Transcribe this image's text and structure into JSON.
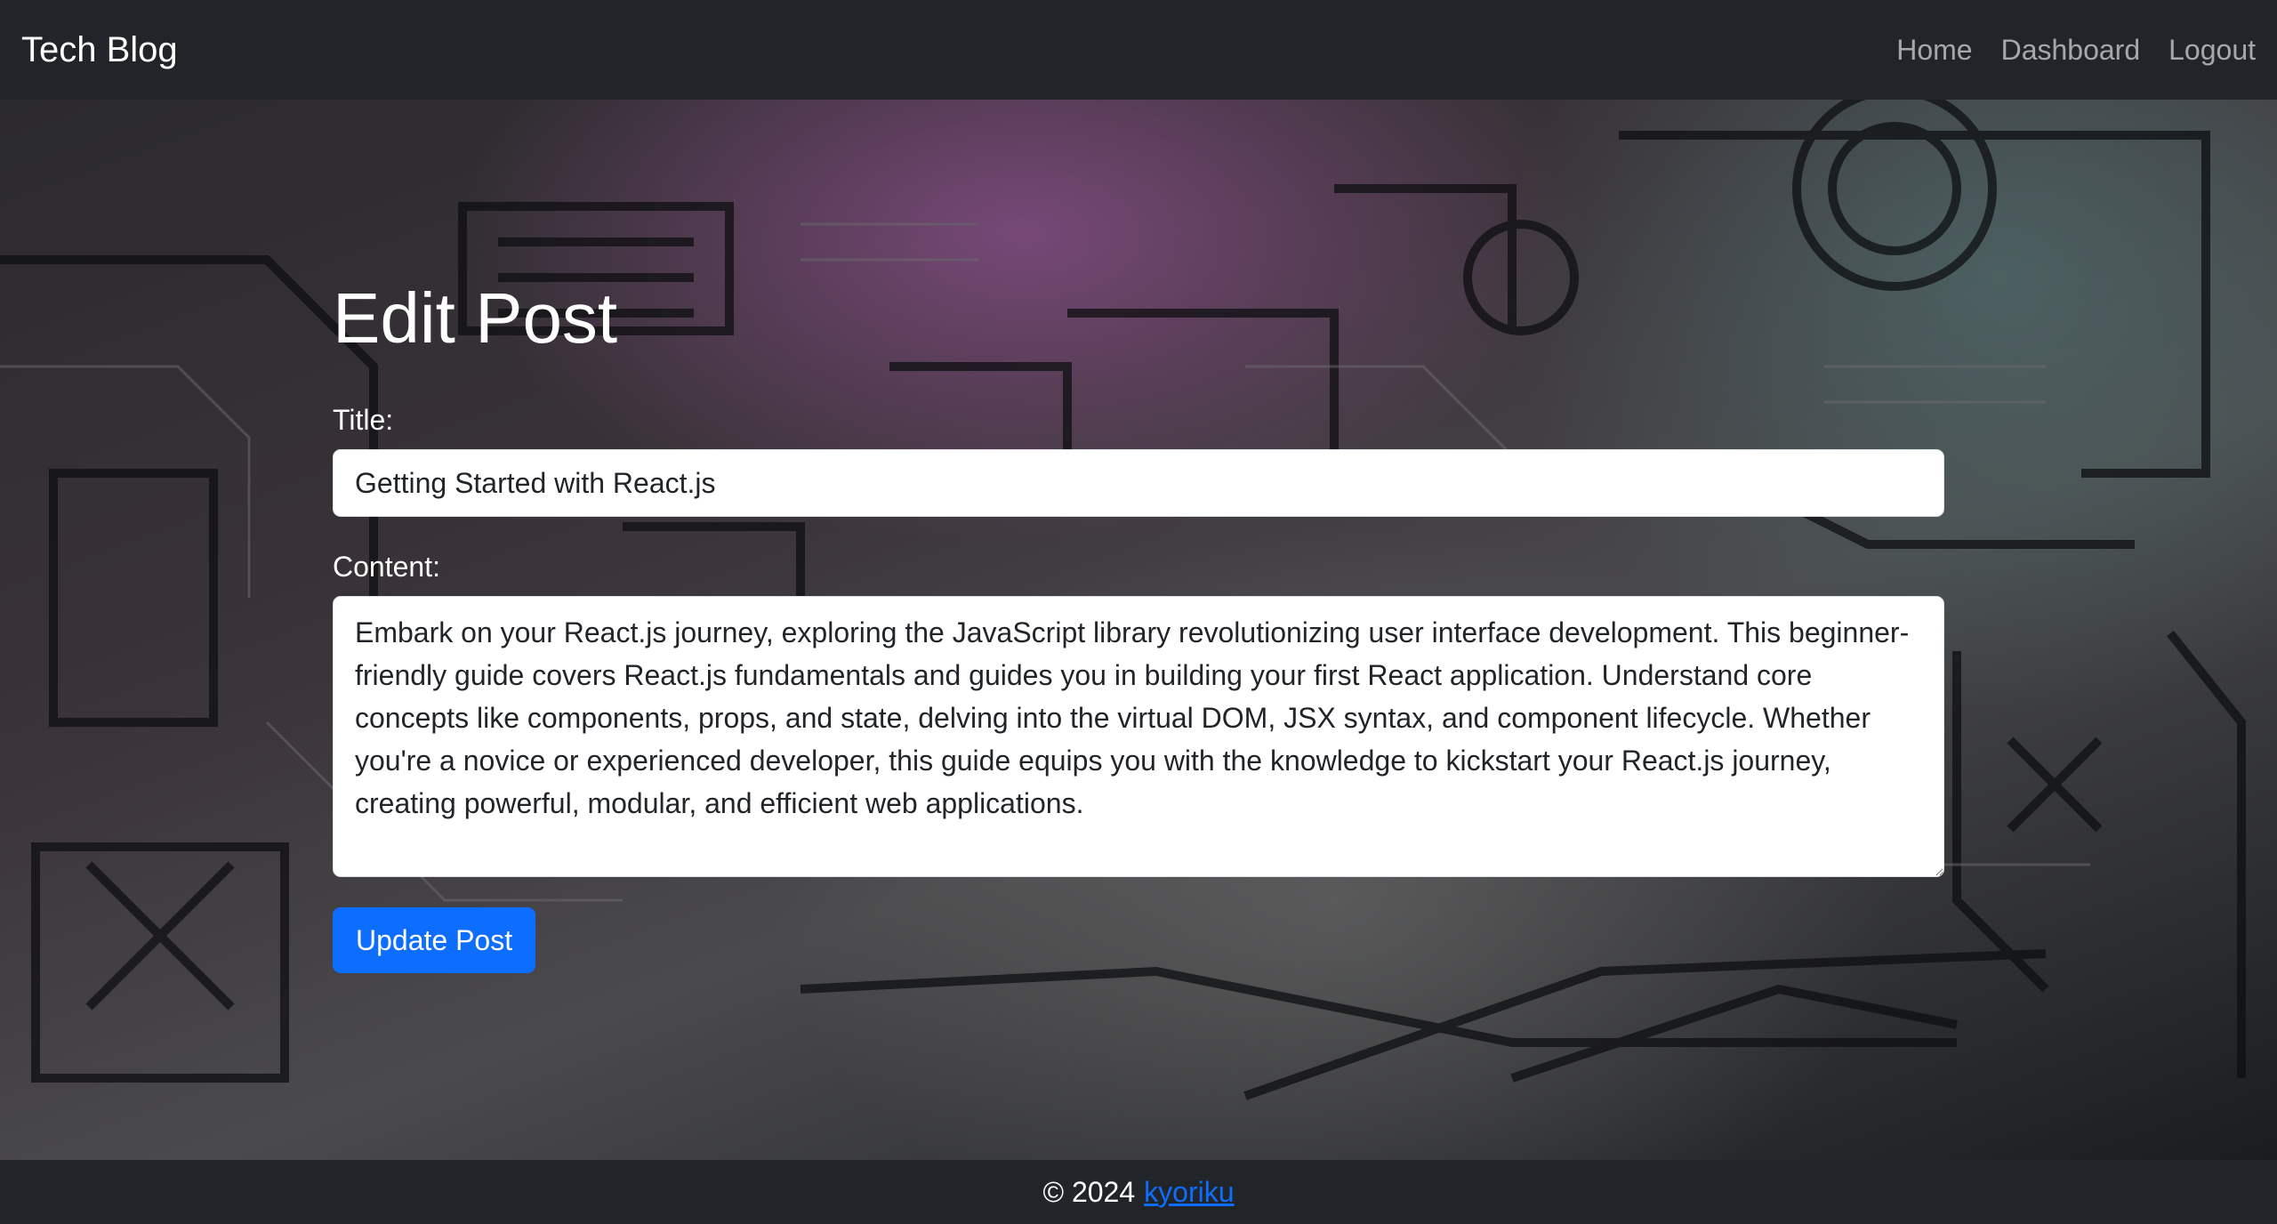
{
  "navbar": {
    "brand": "Tech Blog",
    "links": [
      "Home",
      "Dashboard",
      "Logout"
    ]
  },
  "main": {
    "heading": "Edit Post",
    "title_label": "Title:",
    "title_value": "Getting Started with React.js",
    "content_label": "Content:",
    "content_value": "Embark on your React.js journey, exploring the JavaScript library revolutionizing user interface development. This beginner-friendly guide covers React.js fundamentals and guides you in building your first React application. Understand core concepts like components, props, and state, delving into the virtual DOM, JSX syntax, and component lifecycle. Whether you're a novice or experienced developer, this guide equips you with the knowledge to kickstart your React.js journey, creating powerful, modular, and efficient web applications.",
    "submit_label": "Update Post"
  },
  "footer": {
    "copyright": "© 2024",
    "author_link": "kyoriku"
  },
  "colors": {
    "navbar_bg": "#212529",
    "primary": "#0d6efd",
    "text_light": "#ffffff"
  }
}
